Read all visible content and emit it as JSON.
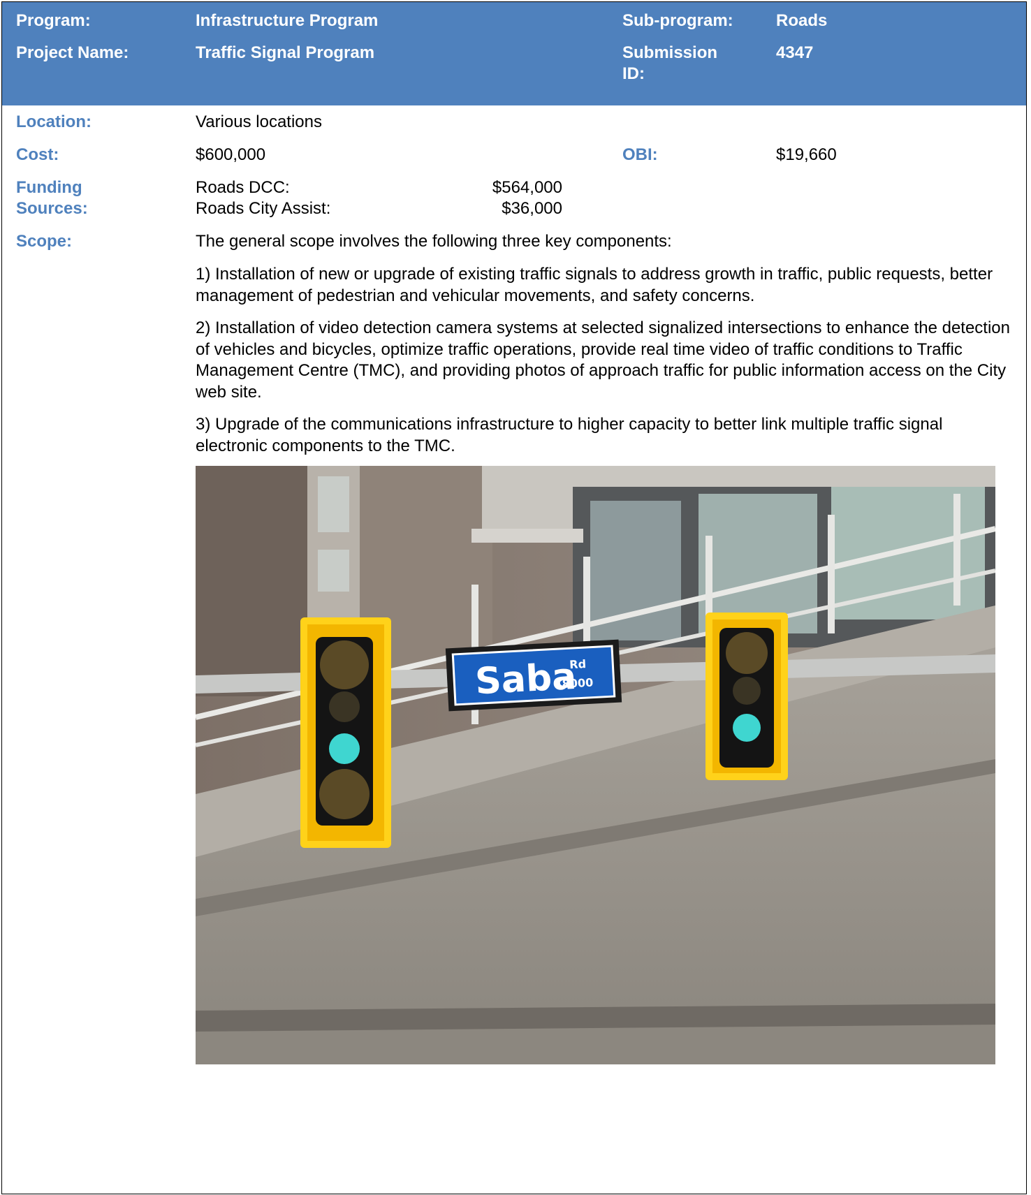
{
  "header": {
    "program_label": "Program:",
    "program_value": "Infrastructure Program",
    "subprogram_label": "Sub-program:",
    "subprogram_value": "Roads",
    "project_label": "Project Name:",
    "project_value": "Traffic Signal Program",
    "submission_label": "Submission ID:",
    "submission_value": "4347"
  },
  "details": {
    "location_label": "Location:",
    "location_value": "Various locations",
    "cost_label": "Cost:",
    "cost_value": "$600,000",
    "obi_label": "OBI:",
    "obi_value": "$19,660",
    "funding_label": "Funding Sources:",
    "funding": [
      {
        "name": "Roads DCC:",
        "amount": "$564,000"
      },
      {
        "name": "Roads City Assist:",
        "amount": "$36,000"
      }
    ],
    "scope_label": "Scope:",
    "scope_intro": "The general scope involves the following three key components:",
    "scope_items": [
      "1) Installation of new or upgrade of existing traffic signals to address growth in traffic, public requests, better management of pedestrian and vehicular movements, and safety concerns.",
      "2) Installation of video detection camera systems at selected signalized intersections to enhance the detection of vehicles and bicycles, optimize traffic operations, provide real time video of traffic conditions to Traffic Management Centre (TMC), and providing photos of approach traffic for public information access on the City web site.",
      "3) Upgrade of the communications infrastructure to higher capacity to better link multiple traffic signal electronic components to the TMC."
    ]
  },
  "photo": {
    "sign_name": "Saba",
    "sign_suffix": "Rd",
    "sign_number": "8000"
  },
  "colors": {
    "header_bg": "#4f81bd",
    "label_text": "#4f81bd",
    "sign_blue": "#1a5fbf",
    "signal_yellow": "#ffd21a",
    "signal_green": "#3fd6d0"
  }
}
